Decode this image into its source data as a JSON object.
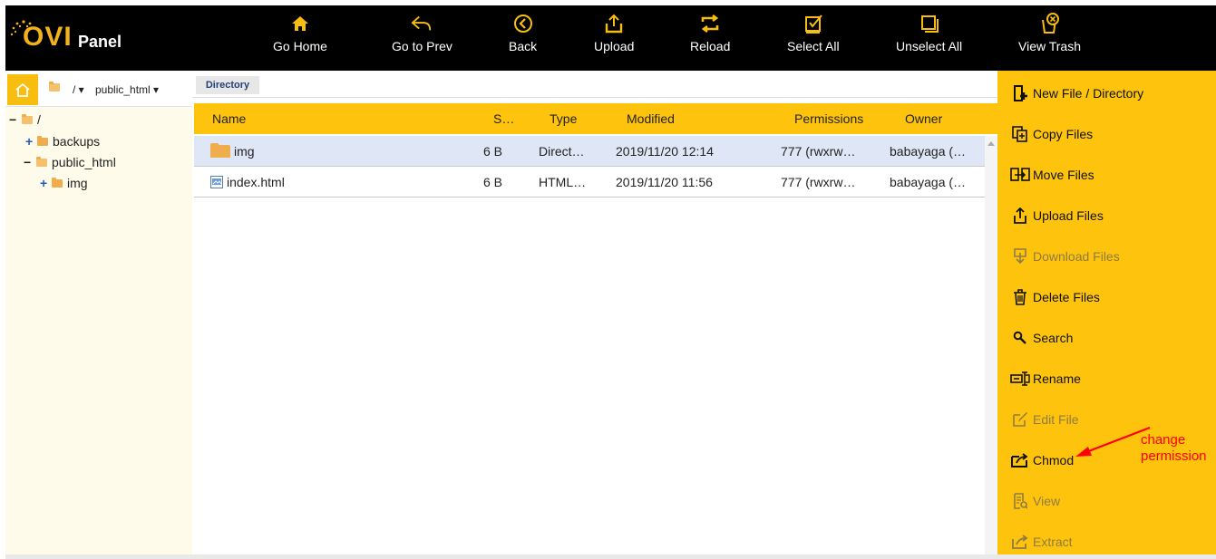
{
  "logo": {
    "brand": "OVI",
    "product": "Panel"
  },
  "toolbar": [
    {
      "label": "Go Home",
      "icon": "home-icon"
    },
    {
      "label": "Go to Prev",
      "icon": "reply-icon"
    },
    {
      "label": "Back",
      "icon": "circle-left-icon"
    },
    {
      "label": "Upload",
      "icon": "upload-icon"
    },
    {
      "label": "Reload",
      "icon": "reload-icon"
    },
    {
      "label": "Select All",
      "icon": "checkbox-icon"
    },
    {
      "label": "Unselect All",
      "icon": "uncheck-icon"
    },
    {
      "label": "View Trash",
      "icon": "trash-view-icon"
    }
  ],
  "breadcrumb": {
    "root": "/",
    "current": "public_html"
  },
  "tree": [
    {
      "label": "/",
      "toggle": "−",
      "level": 0,
      "open": true
    },
    {
      "label": "backups",
      "toggle": "+",
      "level": 1,
      "open": false
    },
    {
      "label": "public_html",
      "toggle": "−",
      "level": 1,
      "open": true
    },
    {
      "label": "img",
      "toggle": "+",
      "level": 2,
      "open": false
    }
  ],
  "main": {
    "tab": "Directory",
    "columns": [
      "Name",
      "S…",
      "Type",
      "Modified",
      "Permissions",
      "Owner"
    ],
    "rows": [
      {
        "name": "img",
        "size": "6 B",
        "type": "Direct…",
        "modified": "2019/11/20 12:14",
        "perms": "777 (rwxrw…",
        "owner": "babayaga (…",
        "kind": "folder",
        "selected": true
      },
      {
        "name": "index.html",
        "size": "6 B",
        "type": "HTML…",
        "modified": "2019/11/20 11:56",
        "perms": "777 (rwxrw…",
        "owner": "babayaga (…",
        "kind": "html",
        "selected": false
      }
    ]
  },
  "actions": [
    {
      "label": "New File / Directory",
      "icon": "new-file-icon",
      "enabled": true
    },
    {
      "label": "Copy Files",
      "icon": "copy-icon",
      "enabled": true
    },
    {
      "label": "Move Files",
      "icon": "move-icon",
      "enabled": true
    },
    {
      "label": "Upload Files",
      "icon": "upload-icon",
      "enabled": true
    },
    {
      "label": "Download Files",
      "icon": "download-icon",
      "enabled": false
    },
    {
      "label": "Delete Files",
      "icon": "trash-icon",
      "enabled": true
    },
    {
      "label": "Search",
      "icon": "search-icon",
      "enabled": true
    },
    {
      "label": "Rename",
      "icon": "rename-icon",
      "enabled": true
    },
    {
      "label": "Edit File",
      "icon": "edit-icon",
      "enabled": false
    },
    {
      "label": "Chmod",
      "icon": "chmod-icon",
      "enabled": true
    },
    {
      "label": "View",
      "icon": "view-icon",
      "enabled": false
    },
    {
      "label": "Extract",
      "icon": "extract-icon",
      "enabled": false
    }
  ],
  "annotation": {
    "line1": "change",
    "line2": "permission"
  },
  "colors": {
    "accent": "#fec40d",
    "toolbar_bg": "#000000",
    "annotation": "#ff0000",
    "selected_row": "#dfe7f6"
  }
}
